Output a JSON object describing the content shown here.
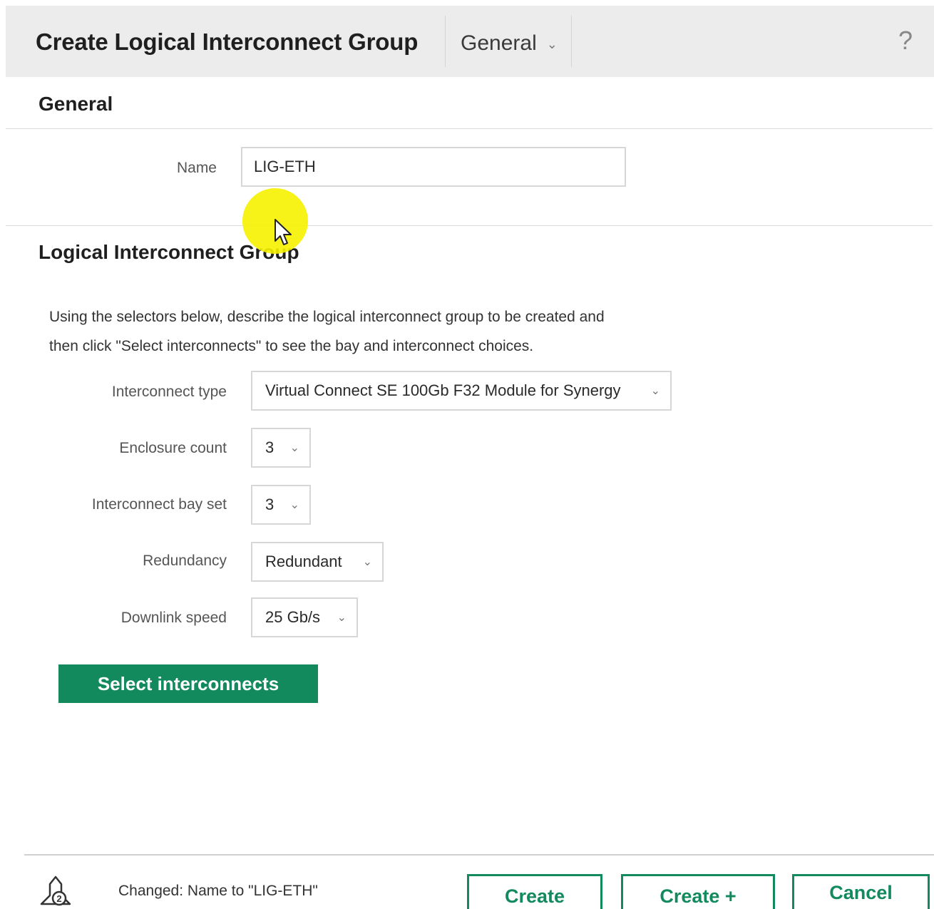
{
  "header": {
    "title": "Create Logical Interconnect Group",
    "view_selector": "General",
    "help": "?"
  },
  "general": {
    "heading": "General",
    "name_label": "Name",
    "name_value": "LIG-ETH"
  },
  "lig": {
    "heading": "Logical Interconnect Group",
    "description_line1": "Using the selectors below, describe the logical interconnect group to be created and",
    "description_line2": "then click \"Select interconnects\" to see the bay and interconnect choices.",
    "fields": {
      "interconnect_type": {
        "label": "Interconnect type",
        "value": "Virtual Connect SE 100Gb F32 Module for Synergy"
      },
      "enclosure_count": {
        "label": "Enclosure count",
        "value": "3"
      },
      "bay_set": {
        "label": "Interconnect bay set",
        "value": "3"
      },
      "redundancy": {
        "label": "Redundancy",
        "value": "Redundant"
      },
      "downlink_speed": {
        "label": "Downlink speed",
        "value": "25 Gb/s"
      }
    },
    "select_button": "Select interconnects"
  },
  "footer": {
    "notification_count": "2",
    "status": "Changed: Name to \"LIG-ETH\"",
    "create": "Create",
    "create_plus": "Create +",
    "cancel": "Cancel"
  },
  "icons": {
    "dropdown": "chevron-down-icon",
    "help": "help-icon",
    "notification": "notification-icon",
    "cursor": "mouse-pointer-icon"
  },
  "colors": {
    "accent": "#138a5e",
    "header_bg": "#ececec",
    "cursor_highlight": "#f6f200"
  }
}
